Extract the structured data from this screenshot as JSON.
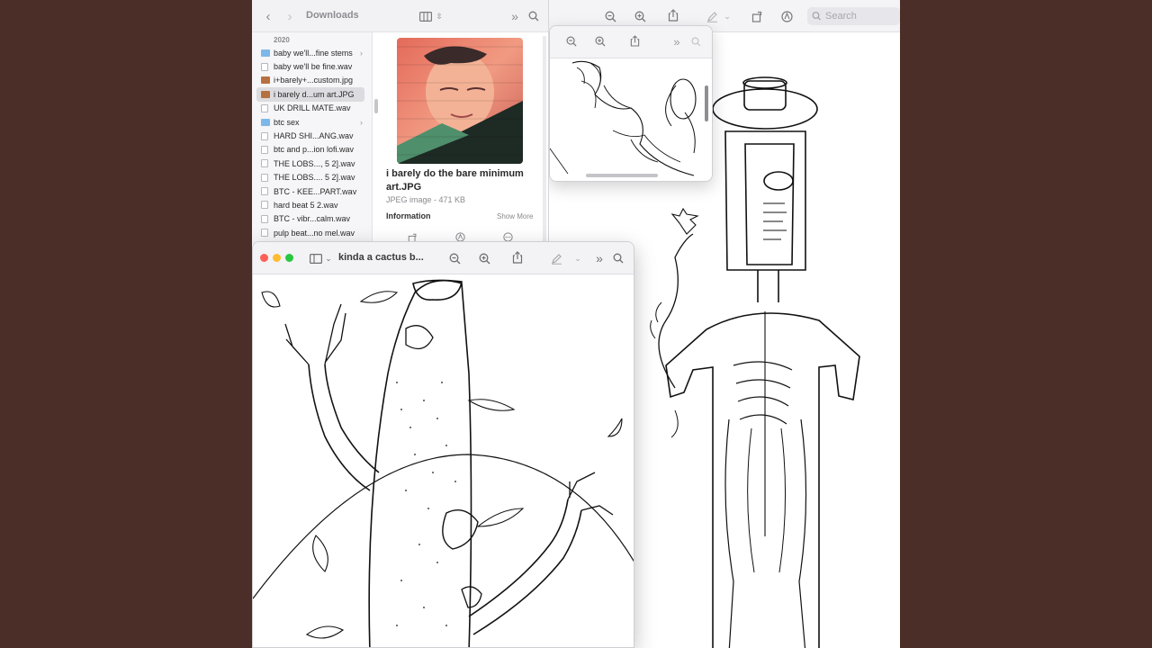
{
  "finder": {
    "title": "Downloads",
    "year_label": "2020",
    "files": [
      {
        "name": "baby we'll...fine stems",
        "kind": "folder",
        "has_children": true
      },
      {
        "name": "baby we'll be fine.wav",
        "kind": "doc"
      },
      {
        "name": "i+barely+...custom.jpg",
        "kind": "img"
      },
      {
        "name": "i barely d...um art.JPG",
        "kind": "img",
        "selected": true
      },
      {
        "name": "UK DRILL MATE.wav",
        "kind": "doc"
      },
      {
        "name": "btc sex",
        "kind": "folder",
        "has_children": true
      },
      {
        "name": "HARD SHI...ANG.wav",
        "kind": "doc"
      },
      {
        "name": "btc and p...ion lofi.wav",
        "kind": "doc"
      },
      {
        "name": "THE LOBS..., 5 2].wav",
        "kind": "doc"
      },
      {
        "name": "THE LOBS.... 5 2].wav",
        "kind": "doc"
      },
      {
        "name": "BTC - KEE...PART.wav",
        "kind": "doc"
      },
      {
        "name": "hard beat 5 2.wav",
        "kind": "doc"
      },
      {
        "name": "BTC - vibr...calm.wav",
        "kind": "doc"
      },
      {
        "name": "pulp beat...no mel.wav",
        "kind": "doc"
      }
    ],
    "preview": {
      "filename": "i barely do the bare minimum art.JPG",
      "meta": "JPEG image - 471 KB",
      "info_heading": "Information",
      "show_more": "Show More"
    }
  },
  "back_window": {
    "search_placeholder": "Search"
  },
  "front_window": {
    "title": "kinda a cactus b..."
  },
  "colors": {
    "desktop": "#4a2e27",
    "toolbar": "#f3f2f5",
    "folder": "#7cb8e9",
    "close": "#fe5f57",
    "minimize": "#febc2e",
    "zoom": "#28c840"
  }
}
